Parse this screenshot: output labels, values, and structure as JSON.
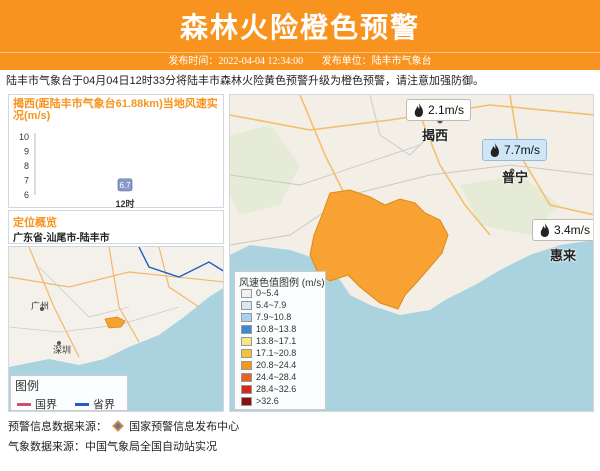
{
  "header": {
    "title": "森林火险橙色预警",
    "publish_time_label": "发布时间：",
    "publish_time": "2022-04-04 12:34:00",
    "publisher_label": "发布单位：",
    "publisher": "陆丰市气象台"
  },
  "description": "陆丰市气象台于04月04日12时33分将陆丰市森林火险黄色预警升级为橙色预警，请注意加强防御。",
  "wind_chart": {
    "title": "揭西(距陆丰市气象台61.88km)当地风速实况(m/s)",
    "chart_data": {
      "type": "scatter",
      "title": "揭西(距陆丰市气象台61.88km)当地风速实况(m/s)",
      "categories": [
        "12时"
      ],
      "values": [
        6.7
      ],
      "data_labels": [
        "6.7"
      ],
      "ylabel": "m/s",
      "yticks": [
        6,
        7,
        8,
        9,
        10
      ],
      "ylim": [
        6,
        10
      ],
      "xlabel": ""
    }
  },
  "location": {
    "title": "定位概览",
    "text": "广东省-汕尾市-陆丰市"
  },
  "minimap": {
    "city_labels": [
      "广州",
      "深圳"
    ],
    "legend_title": "图例",
    "legend_items": [
      {
        "label": "国界",
        "color": "#d0506a"
      },
      {
        "label": "省界",
        "color": "#1f5fbf"
      }
    ]
  },
  "main_map": {
    "stations": [
      {
        "city": "揭西",
        "speed": "2.1m/s",
        "highlight": false
      },
      {
        "city": "普宁",
        "speed": "7.7m/s",
        "highlight": true
      },
      {
        "city": "惠来",
        "speed": "3.4m/s",
        "highlight": false
      }
    ],
    "warning_color": "#f7a233",
    "scale_title": "风速色值图例 (m/s)",
    "scale": [
      {
        "label": "0~5.4",
        "color": "#f0f0f0"
      },
      {
        "label": "5.4~7.9",
        "color": "#d6e8f5"
      },
      {
        "label": "7.9~10.8",
        "color": "#a8d0f0"
      },
      {
        "label": "10.8~13.8",
        "color": "#3f88d8"
      },
      {
        "label": "13.8~17.1",
        "color": "#f7e58a"
      },
      {
        "label": "17.1~20.8",
        "color": "#f3c33c"
      },
      {
        "label": "20.8~24.4",
        "color": "#f39a1e"
      },
      {
        "label": "24.4~28.4",
        "color": "#e8641c"
      },
      {
        "label": "28.4~32.6",
        "color": "#d42a14"
      },
      {
        "label": ">32.6",
        "color": "#8e0f0f"
      }
    ]
  },
  "footer": {
    "warning_source_label": "预警信息数据来源：",
    "warning_source": "国家预警信息发布中心",
    "weather_source": "气象数据来源：中国气象局全国自动站实况"
  }
}
